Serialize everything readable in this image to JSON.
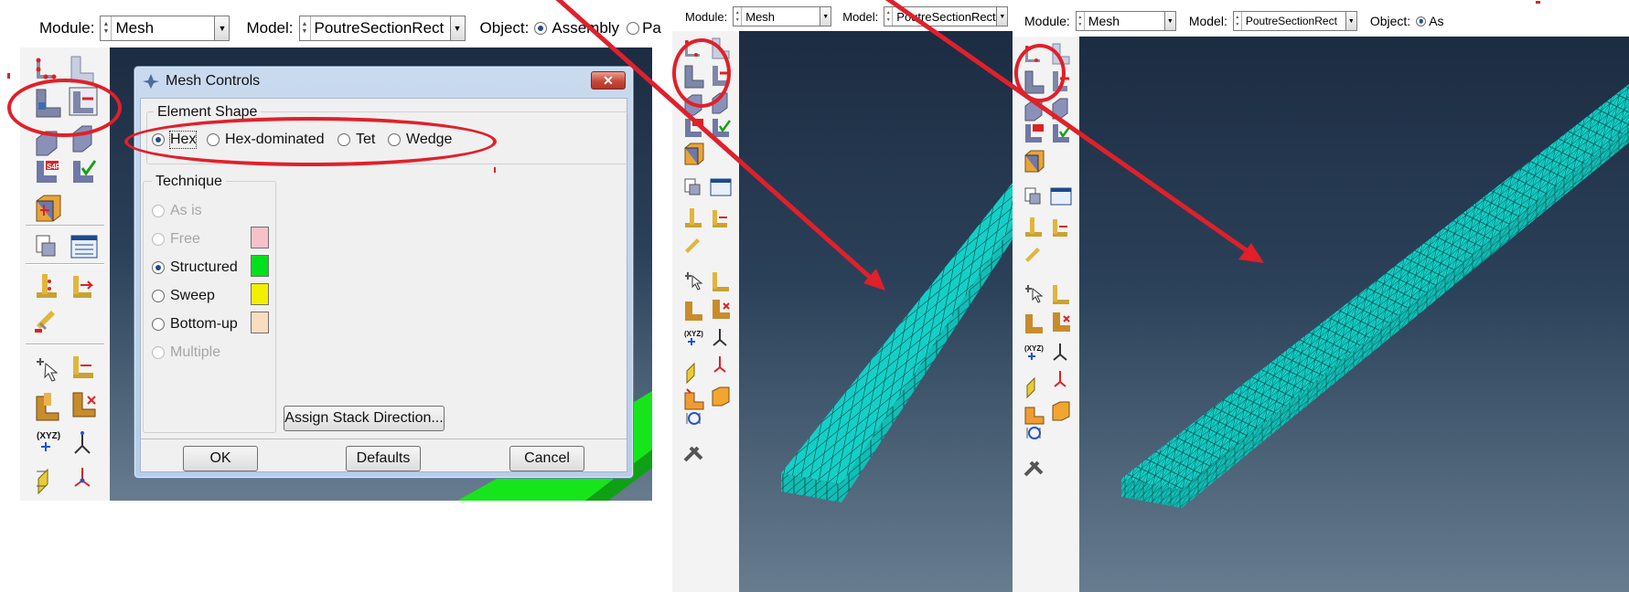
{
  "left": {
    "toolbar": {
      "module_label": "Module:",
      "module_value": "Mesh",
      "model_label": "Model:",
      "model_value": "PoutreSectionRect",
      "object_label": "Object:",
      "object_assembly": "Assembly",
      "object_part_partial": "Pa"
    },
    "dialog": {
      "title": "Mesh Controls",
      "close_label": "✕",
      "element_shape": {
        "title": "Element Shape",
        "options": [
          "Hex",
          "Hex-dominated",
          "Tet",
          "Wedge"
        ],
        "selected": "Hex"
      },
      "technique": {
        "title": "Technique",
        "options": [
          "As is",
          "Free",
          "Structured",
          "Sweep",
          "Bottom-up",
          "Multiple"
        ],
        "selected": "Structured",
        "colors": {
          "Free": "#f4c2c8",
          "Structured": "#00e01b",
          "Sweep": "#f2ef00",
          "Bottom-up": "#fadcbf"
        }
      },
      "assign_stack_label": "Assign Stack Direction...",
      "ok_label": "OK",
      "defaults_label": "Defaults",
      "cancel_label": "Cancel"
    }
  },
  "middle": {
    "toolbar": {
      "module_label": "Module:",
      "module_value": "Mesh",
      "model_label": "Model:",
      "model_value": "PoutreSectionRect"
    }
  },
  "right": {
    "toolbar": {
      "module_label": "Module:",
      "module_value": "Mesh",
      "model_label": "Model:",
      "model_value": "PoutreSectionRect",
      "object_label": "Object:",
      "object_value_partial": "As"
    }
  },
  "icons": {
    "xyz_label": "(XYZ)",
    "s4r_label": "S4R"
  },
  "colors": {
    "annotation_red": "#e0202a",
    "mesh_cyan": "#14cfc8",
    "viewport_top": "#1c2c42",
    "viewport_bottom": "#677c8f",
    "green_part": "#17e51c"
  }
}
